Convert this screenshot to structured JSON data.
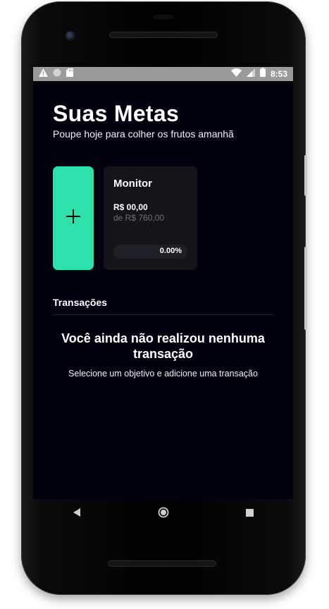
{
  "status_bar": {
    "time": "8:53",
    "left_icons": [
      "warning-icon",
      "circle-icon",
      "sd-card-icon"
    ],
    "right_icons": [
      "wifi-icon",
      "signal-icon",
      "battery-icon"
    ]
  },
  "header": {
    "title": "Suas Metas",
    "subtitle": "Poupe hoje para colher os frutos amanhã"
  },
  "add_goal": {
    "icon": "plus-icon",
    "color": "#2ee0aa"
  },
  "goals": [
    {
      "name": "Monitor",
      "saved": "R$ 00,00",
      "target": "de R$ 760,00",
      "progress_label": "0.00%",
      "progress_fraction": 0.0
    }
  ],
  "transactions": {
    "title": "Transações",
    "empty_title": "Você ainda não realizou nenhuma transação",
    "empty_subtitle": "Selecione um objetivo e adicione uma transação"
  },
  "navigation": [
    "back-icon",
    "home-icon",
    "recents-icon"
  ],
  "colors": {
    "accent": "#2ee0aa",
    "background": "#02020f",
    "card": "#141419"
  }
}
